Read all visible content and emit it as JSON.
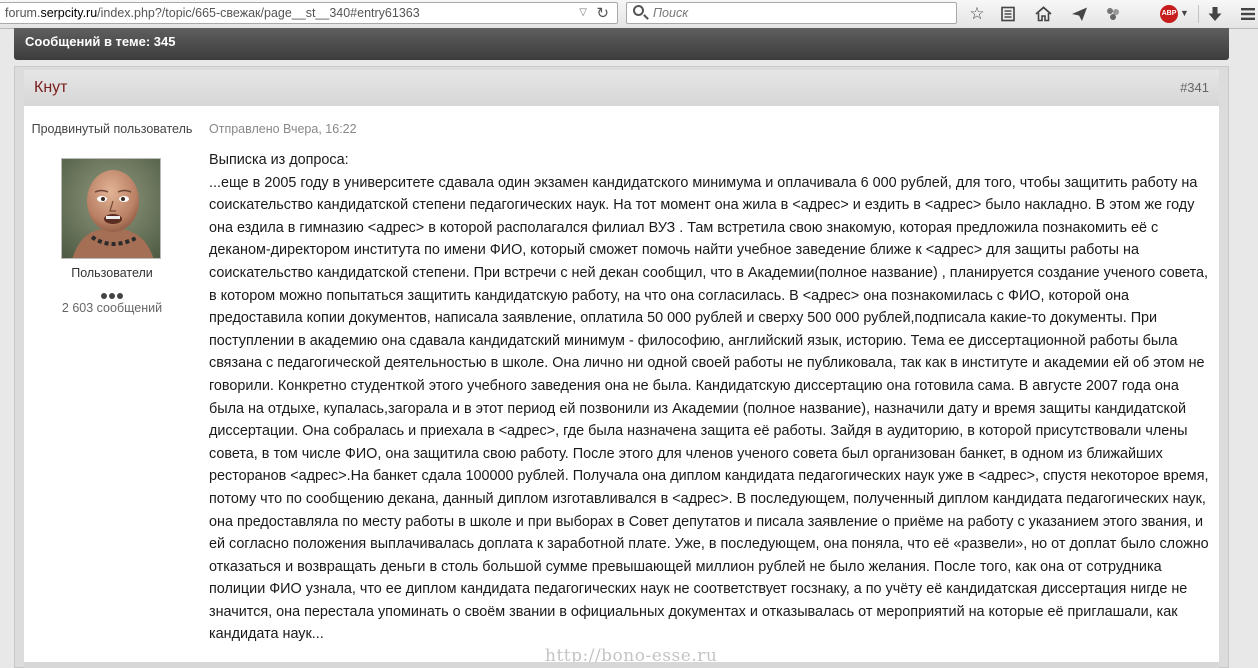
{
  "browser": {
    "url_prefix": "forum.",
    "url_domain": "serpcity.ru",
    "url_path": "/index.php?/topic/665-свежак/page__st__340#entry61363",
    "search_placeholder": "Поиск",
    "icons": [
      "bookmark-star-icon",
      "reading-list-icon",
      "home-icon",
      "send-icon",
      "addon-icon",
      "adblock-icon",
      "download-icon",
      "menu-icon"
    ],
    "adblock_label": "ABP"
  },
  "topic": {
    "messages_count_label": "Сообщений в теме: 345"
  },
  "post": {
    "author": "Кнут",
    "number": "#341",
    "author_rank": "Продвинутый пользователь",
    "author_group": "Пользователи",
    "author_post_count": "2 603 сообщений",
    "posted_at": "Отправлено Вчера, 16:22",
    "heading": "Выписка из допроса:",
    "body": "...еще в 2005 году в  университете сдавала один экзамен кандидатского минимума и оплачивала 6 000 рублей, для того, чтобы защитить работу на соискательство кандидатской степени педагогических наук. На тот момент она жила в <адрес> и ездить в <адрес> было накладно. В этом же году она ездила в  гимназию <адрес> в которой располагался филиал ВУЗ . Там встретила свою знакомую, которая предложила познакомить её с деканом-директором института по имени ФИО, который сможет помочь найти учебное заведение ближе к <адрес> для защиты работы на соискательство кандидатской степени.  При встречи с ней декан сообщил, что в Академии(полное название) , планируется создание ученого совета, в котором можно попытаться защитить кандидатскую работу, на что она согласилась. В <адрес> она познакомилась с ФИО, которой она предоставила копии документов, написала заявление, оплатила 50 000 рублей и сверху 500 000 рублей,подписала какие-то документы. При поступлении в академию  она сдавала кандидатский минимум - философию, английский язык, историю. Тема ее диссертационной работы была связана с педагогической деятельностью в школе. Она лично ни одной своей работы не публиковала, так как в институте и академии ей об этом не говорили. Конкретно студенткой этого учебного заведения она не была. Кандидатскую диссертацию она готовила сама. В августе 2007 года она была на отдыхе, купалась,загорала и в этот период ей позвонили из Академии (полное название), назначили дату и время защиты кандидатской диссертации. Она собралась и приехала в <адрес>, где была назначена защита её работы. Зайдя в аудиторию, в которой присутствовали члены совета, в том числе ФИО, она защитила свою работу. После этого для членов ученого совета был организован банкет, в одном из ближайших ресторанов <адрес>.На банкет сдала 100000 рублей. Получала она диплом кандидата педагогических наук уже в <адрес>, спустя некоторое время, потому что по сообщению декана, данный диплом изготавливался в <адрес>. В последующем, полученный диплом кандидата педагогических наук, она предоставляла по месту работы в школе и при выборах в  Совет депутатов и писала заявление о приёме на работу  с указанием этого звания, и ей согласно положения выплачивалась доплата к заработной плате. Уже, в последующем, она поняла, что её «развели», но от доплат было сложно отказаться и возвращать деньги в столь большой сумме превышающей миллион рублей не было желания. После того, как она от сотрудника полиции ФИО узнала, что ее диплом кандидата педагогических наук не соответствует госзнаку, а по учёту её кандидатская диссертация нигде не значится, она перестала упоминать о своём звании в официальных документах и отказывалась от мероприятий на которые её приглашали, как кандидата наук..."
  },
  "watermark": "http://bono-esse.ru",
  "colors": {
    "author_name": "#7a1e1e",
    "topic_bar": "#4a4a4a",
    "adblock": "#c71d1d"
  }
}
